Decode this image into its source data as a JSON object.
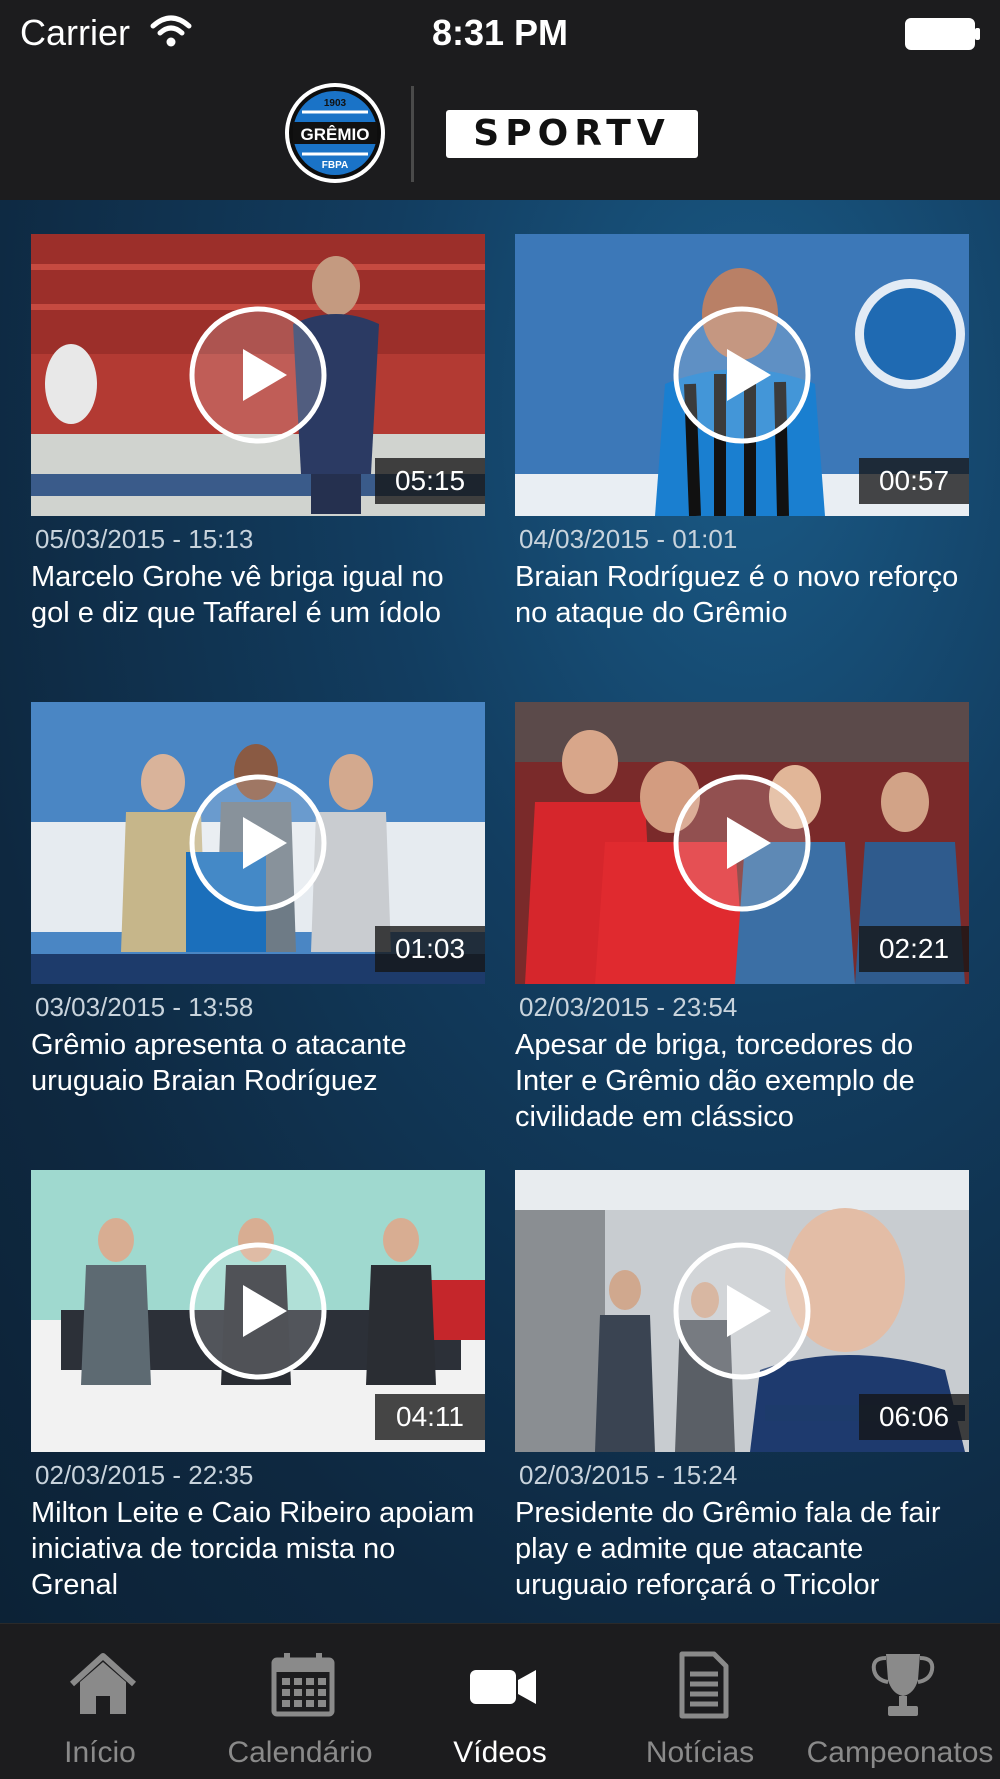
{
  "status_bar": {
    "carrier": "Carrier",
    "time": "8:31 PM"
  },
  "header": {
    "gremio_logo_text": {
      "year": "1903",
      "name": "GRÊMIO",
      "sub": "FBPA"
    },
    "sportv_logo_text": "SPORTV"
  },
  "videos": [
    {
      "date": "05/03/2015 - 15:13",
      "title": "Marcelo Grohe vê briga igual no gol e diz que Taffarel é um ídolo",
      "duration": "05:15"
    },
    {
      "date": "04/03/2015 - 01:01",
      "title": "Braian Rodríguez é o novo reforço no ataque do Grêmio",
      "duration": "00:57"
    },
    {
      "date": "03/03/2015 - 13:58",
      "title": "Grêmio apresenta o atacante uruguaio Braian Rodríguez",
      "duration": "01:03"
    },
    {
      "date": "02/03/2015 - 23:54",
      "title": "Apesar de briga, torcedores do Inter e Grêmio dão exemplo de civilidade em clássico",
      "duration": "02:21"
    },
    {
      "date": "02/03/2015 - 22:35",
      "title": "Milton Leite e Caio Ribeiro apoiam iniciativa de torcida mista no Grenal",
      "duration": "04:11"
    },
    {
      "date": "02/03/2015 - 15:24",
      "title": "Presidente do Grêmio fala de fair play e admite que atacante uruguaio reforçará o Tricolor",
      "duration": "06:06"
    }
  ],
  "tabs": [
    {
      "label": "Início",
      "icon": "home-icon"
    },
    {
      "label": "Calendário",
      "icon": "calendar-icon"
    },
    {
      "label": "Vídeos",
      "icon": "video-camera-icon",
      "active": true
    },
    {
      "label": "Notícias",
      "icon": "document-icon"
    },
    {
      "label": "Campeonatos",
      "icon": "trophy-icon"
    }
  ],
  "colors": {
    "header_bg": "#1c1c1e",
    "content_bg": "#123d60",
    "active_tab": "#ffffff",
    "inactive_tab": "#8a8a8a"
  }
}
